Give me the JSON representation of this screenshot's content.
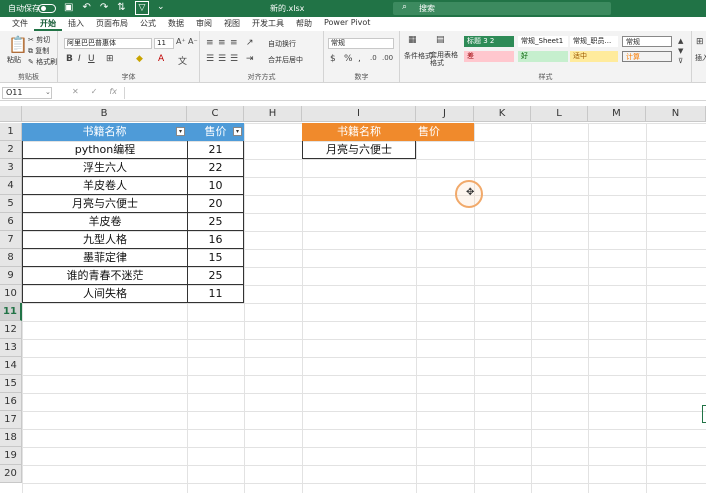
{
  "titlebar": {
    "autosave_label": "自动保存",
    "filename": "新的.xlsx",
    "search_placeholder": "搜索"
  },
  "tabs": [
    "文件",
    "开始",
    "插入",
    "页面布局",
    "公式",
    "数据",
    "审阅",
    "视图",
    "开发工具",
    "帮助",
    "Power Pivot"
  ],
  "ribbon": {
    "clipboard": {
      "paste": "粘贴",
      "cut": "剪切",
      "copy": "复制",
      "format_painter": "格式刷",
      "label": "剪贴板"
    },
    "font": {
      "font_name": "阿里巴巴普惠体",
      "font_size": "11",
      "label": "字体"
    },
    "align": {
      "wrap": "自动换行",
      "merge": "合并后居中",
      "label": "对齐方式"
    },
    "number": {
      "format": "常规",
      "label": "数字"
    },
    "styles": {
      "cond_format": "条件格式",
      "table_format": "套用表格格式",
      "cells": [
        "标题 3 2",
        "常规_Sheet1",
        "常规_职员...",
        "常规",
        "差",
        "好",
        "适中",
        "计算"
      ],
      "label": "样式"
    },
    "insert": "插入"
  },
  "formula_bar": {
    "name_box": "O11",
    "formula": ""
  },
  "columns": [
    "B",
    "C",
    "H",
    "I",
    "J",
    "K",
    "L",
    "M",
    "N"
  ],
  "rows": [
    "1",
    "2",
    "3",
    "4",
    "5",
    "6",
    "7",
    "8",
    "9",
    "10",
    "11",
    "12",
    "13",
    "14",
    "15",
    "16",
    "17",
    "18",
    "19",
    "20"
  ],
  "selected_row": "11",
  "table_main": {
    "header_name": "书籍名称",
    "header_price": "售价",
    "rows": [
      {
        "name": "python编程",
        "price": "21"
      },
      {
        "name": "浮生六人",
        "price": "22"
      },
      {
        "name": "羊皮卷人",
        "price": "10"
      },
      {
        "name": "月亮与六便士",
        "price": "20"
      },
      {
        "name": "羊皮卷",
        "price": "25"
      },
      {
        "name": "九型人格",
        "price": "16"
      },
      {
        "name": "墨菲定律",
        "price": "15"
      },
      {
        "name": "谁的青春不迷茫",
        "price": "25"
      },
      {
        "name": "人间失格",
        "price": "11"
      }
    ]
  },
  "table_lookup": {
    "header_name": "书籍名称",
    "header_price": "售价",
    "row_name": "月亮与六便士",
    "row_price": ""
  }
}
